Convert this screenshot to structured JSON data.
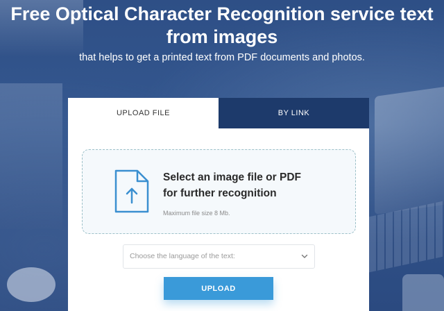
{
  "hero": {
    "title": "Free Optical Character Recognition service text from images",
    "subtitle": "that helps to get a printed text from PDF documents and photos."
  },
  "tabs": [
    {
      "label": "UPLOAD FILE",
      "active": true
    },
    {
      "label": "BY LINK",
      "active": false
    }
  ],
  "dropzone": {
    "title_line1": "Select an image file or PDF",
    "title_line2": "for further recognition",
    "hint": "Maximum file size 8 Mb.",
    "icon": "file-upload-icon"
  },
  "language_select": {
    "placeholder": "Choose the language of the text:",
    "icon": "chevron-down-icon"
  },
  "upload_button": {
    "label": "UPLOAD"
  },
  "colors": {
    "background": "#2e4f86",
    "active_tab": "#ffffff",
    "inactive_tab": "#1d3a6b",
    "accent": "#3a9ad9",
    "icon": "#3a8fd0"
  }
}
